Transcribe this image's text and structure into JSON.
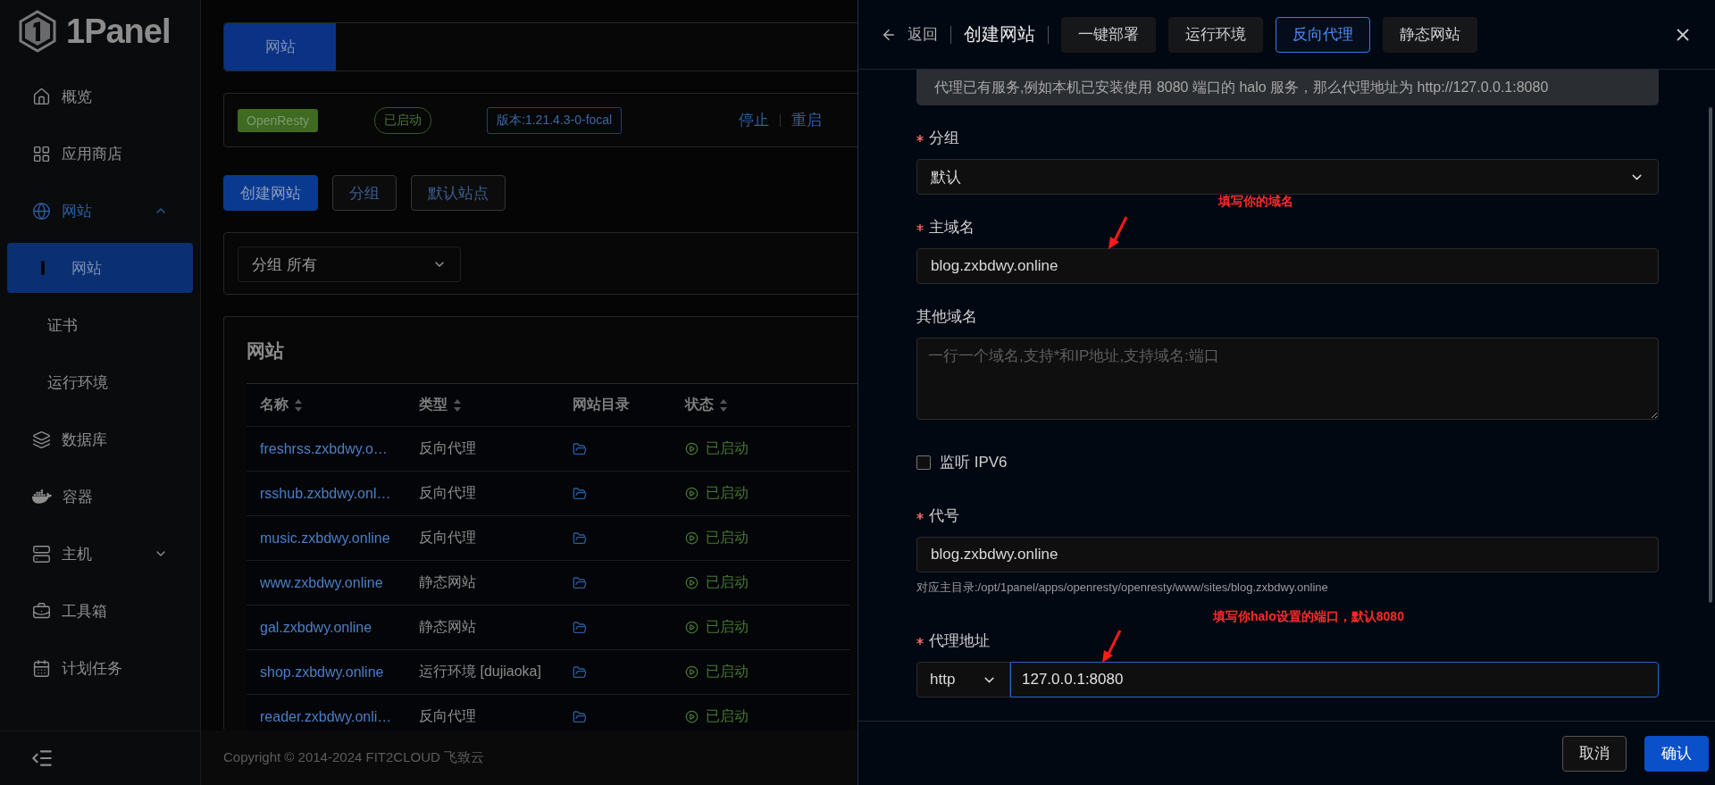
{
  "sidebar": {
    "logo": "1Panel",
    "items": [
      {
        "label": "概览",
        "selected": false
      },
      {
        "label": "应用商店",
        "selected": false
      },
      {
        "label": "网站",
        "expanded": true,
        "selected": true,
        "children": [
          {
            "label": "网站",
            "selected": true
          },
          {
            "label": "证书",
            "selected": false
          },
          {
            "label": "运行环境",
            "selected": false
          }
        ]
      },
      {
        "label": "数据库",
        "selected": false
      },
      {
        "label": "容器",
        "selected": false
      },
      {
        "label": "主机",
        "expanded": false,
        "selected": false
      },
      {
        "label": "工具箱",
        "selected": false
      },
      {
        "label": "计划任务",
        "selected": false
      }
    ]
  },
  "main": {
    "tabs": [
      {
        "label": "网站",
        "selected": true
      }
    ],
    "server": {
      "name": "OpenResty",
      "status": "已启动",
      "version": "版本:1.21.4.3-0-focal",
      "actions": [
        "停止",
        "重启"
      ]
    },
    "buttons": [
      {
        "label": "创建网站",
        "kind": "primary"
      },
      {
        "label": "分组",
        "kind": "default"
      },
      {
        "label": "默认站点",
        "kind": "default"
      }
    ],
    "filter": {
      "label": "分组",
      "value": "所有"
    },
    "table": {
      "title": "网站",
      "columns": [
        {
          "label": "名称",
          "sortable": true
        },
        {
          "label": "类型",
          "sortable": true
        },
        {
          "label": "网站目录"
        },
        {
          "label": "状态",
          "sortable": true
        }
      ],
      "rows": [
        {
          "name": "freshrss.zxbdwy.o…",
          "type": "反向代理",
          "status": "已启动"
        },
        {
          "name": "rsshub.zxbdwy.onl…",
          "type": "反向代理",
          "status": "已启动"
        },
        {
          "name": "music.zxbdwy.online",
          "type": "反向代理",
          "status": "已启动"
        },
        {
          "name": "www.zxbdwy.online",
          "type": "静态网站",
          "status": "已启动"
        },
        {
          "name": "gal.zxbdwy.online",
          "type": "静态网站",
          "status": "已启动"
        },
        {
          "name": "shop.zxbdwy.online",
          "type": "运行环境 [dujiaoka]",
          "status": "已启动"
        },
        {
          "name": "reader.zxbdwy.onli…",
          "type": "反向代理",
          "status": "已启动"
        }
      ]
    },
    "footer": "Copyright © 2014-2024 FIT2CLOUD 飞致云"
  },
  "drawer": {
    "back": "返回",
    "title": "创建网站",
    "tabs": [
      {
        "label": "一键部署",
        "selected": false
      },
      {
        "label": "运行环境",
        "selected": false
      },
      {
        "label": "反向代理",
        "selected": true
      },
      {
        "label": "静态网站",
        "selected": false
      }
    ],
    "notice": "代理已有服务,例如本机已安装使用 8080 端口的 halo 服务，那么代理地址为 http://127.0.0.1:8080",
    "fields": [
      {
        "kind": "select",
        "label": "分组",
        "required": true,
        "value": "默认"
      },
      {
        "kind": "input",
        "label": "主域名",
        "required": true,
        "value": "blog.zxbdwy.online",
        "annotation": "填写你的域名"
      },
      {
        "kind": "textarea",
        "label": "其他域名",
        "placeholder": "一行一个域名,支持*和IP地址,支持域名:端口"
      },
      {
        "kind": "checkbox",
        "label": "监听 IPV6",
        "checked": false
      },
      {
        "kind": "input",
        "label": "代号",
        "required": true,
        "value": "blog.zxbdwy.online",
        "hint": "对应主目录:/opt/1panel/apps/openresty/openresty/www/sites/blog.zxbdwy.online"
      },
      {
        "kind": "address",
        "label": "代理地址",
        "required": true,
        "scheme": "http",
        "value": "127.0.0.1:8080",
        "focused": true,
        "annotation": "填写你halo设置的端口，默认8080"
      }
    ],
    "buttons": [
      {
        "label": "取消",
        "kind": "default"
      },
      {
        "label": "确认",
        "kind": "primary"
      }
    ]
  }
}
